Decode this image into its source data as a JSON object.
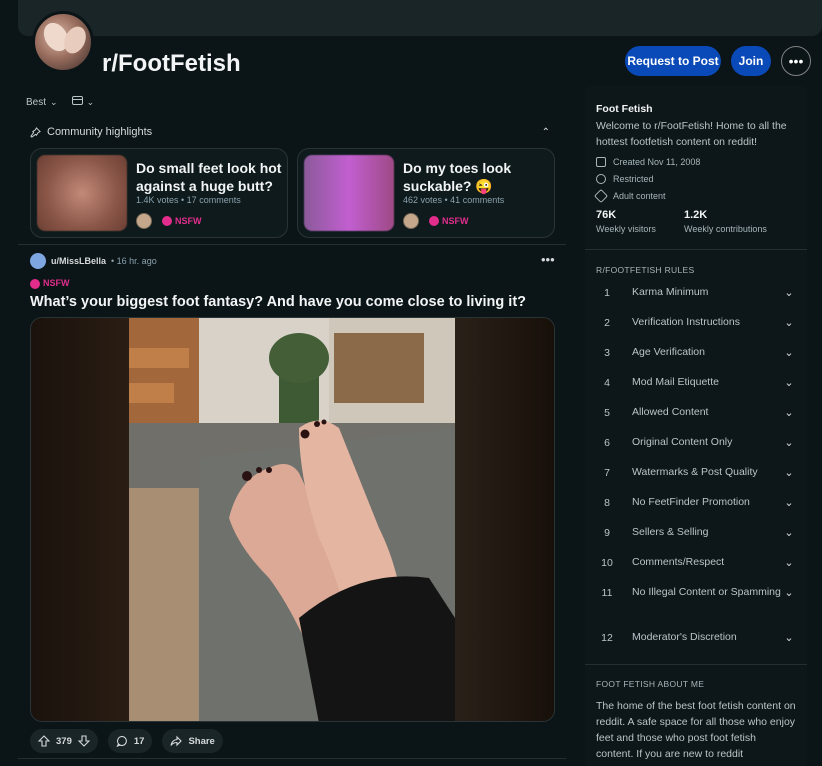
{
  "subreddit": {
    "name": "r/FootFetish",
    "request_label": "Request to Post",
    "join_label": "Join",
    "more_label": "•••"
  },
  "feed": {
    "sort_label": "Best",
    "highlights_label": "Community highlights",
    "highlights": [
      {
        "title": "Do small feet look hot against a huge butt?",
        "meta": "1.4K votes • 17 comments",
        "badge": "NSFW"
      },
      {
        "title": "Do my toes look suckable? 😜",
        "meta": "462 votes • 41 comments",
        "badge": "NSFW"
      }
    ]
  },
  "post": {
    "author": "u/MissLBella",
    "time": "• 16 hr. ago",
    "badge": "NSFW",
    "title": "What’s your biggest foot fantasy? And have you come close to living it?",
    "votes": "379",
    "comments": "17",
    "share_label": "Share"
  },
  "sidebar": {
    "name": "Foot Fetish",
    "description": "Welcome to r/FootFetish! Home to all the hottest footfetish content on reddit!",
    "created": "Created Nov 11, 2008",
    "restricted": "Restricted",
    "adult": "Adult content",
    "visitors_num": "76K",
    "visitors_label": "Weekly visitors",
    "contrib_num": "1.2K",
    "contrib_label": "Weekly contributions",
    "rules_heading": "R/FOOTFETISH RULES",
    "rules": [
      {
        "n": "1",
        "t": "Karma Minimum"
      },
      {
        "n": "2",
        "t": "Verification Instructions"
      },
      {
        "n": "3",
        "t": "Age Verification"
      },
      {
        "n": "4",
        "t": "Mod Mail Etiquette"
      },
      {
        "n": "5",
        "t": "Allowed Content"
      },
      {
        "n": "6",
        "t": "Original Content Only"
      },
      {
        "n": "7",
        "t": "Watermarks & Post Quality"
      },
      {
        "n": "8",
        "t": "No FeetFinder Promotion"
      },
      {
        "n": "9",
        "t": "Sellers & Selling"
      },
      {
        "n": "10",
        "t": "Comments/Respect"
      },
      {
        "n": "11",
        "t": "No Illegal Content or Spamming"
      },
      {
        "n": "12",
        "t": "Moderator's Discretion"
      }
    ],
    "about_heading": "FOOT FETISH ABOUT ME",
    "about_text": "The home of the best foot fetish content on reddit. A safe space for all those who enjoy feet and those who post foot fetish content. If you are new to reddit"
  }
}
